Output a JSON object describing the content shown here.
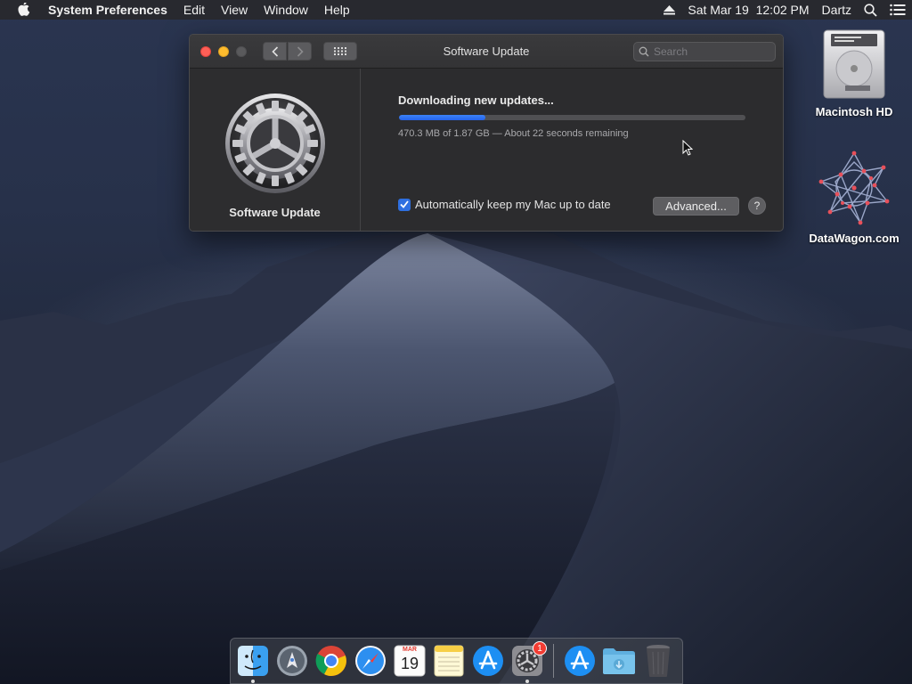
{
  "menubar": {
    "app_name": "System Preferences",
    "items": [
      "Edit",
      "View",
      "Window",
      "Help"
    ],
    "datetime": "Sat Mar 19  12:02 PM",
    "user": "Dartz"
  },
  "window": {
    "title": "Software Update",
    "search_placeholder": "Search",
    "sidebar_label": "Software Update",
    "status": "Downloading new updates...",
    "progress_fraction": 0.25,
    "detail": "470.3 MB of 1.87 GB — About 22 seconds remaining",
    "auto_update_label": "Automatically keep my Mac up to date",
    "auto_update_checked": true,
    "advanced_label": "Advanced...",
    "help_label": "?"
  },
  "desktop_icons": [
    {
      "label": "Macintosh HD",
      "icon": "hard-drive-icon"
    },
    {
      "label": "DataWagon.com",
      "icon": "datawagon-logo-icon"
    }
  ],
  "dock": {
    "apps": [
      {
        "name": "finder",
        "icon": "finder-icon",
        "running": true
      },
      {
        "name": "launchpad",
        "icon": "launchpad-icon",
        "running": false
      },
      {
        "name": "chrome",
        "icon": "chrome-icon",
        "running": false
      },
      {
        "name": "safari",
        "icon": "safari-icon",
        "running": false
      },
      {
        "name": "calendar",
        "icon": "calendar-icon",
        "running": false
      },
      {
        "name": "notes",
        "icon": "notes-icon",
        "running": false
      },
      {
        "name": "app-store",
        "icon": "app-store-icon",
        "running": false
      },
      {
        "name": "system-preferences",
        "icon": "system-preferences-icon",
        "running": true
      }
    ],
    "calendar_month": "MAR",
    "calendar_day": "19",
    "sysprefs_badge": "1"
  },
  "colors": {
    "accent": "#2e6fe0",
    "close": "#fe5f57",
    "minimize": "#febc2e",
    "badge": "#f23c33"
  }
}
